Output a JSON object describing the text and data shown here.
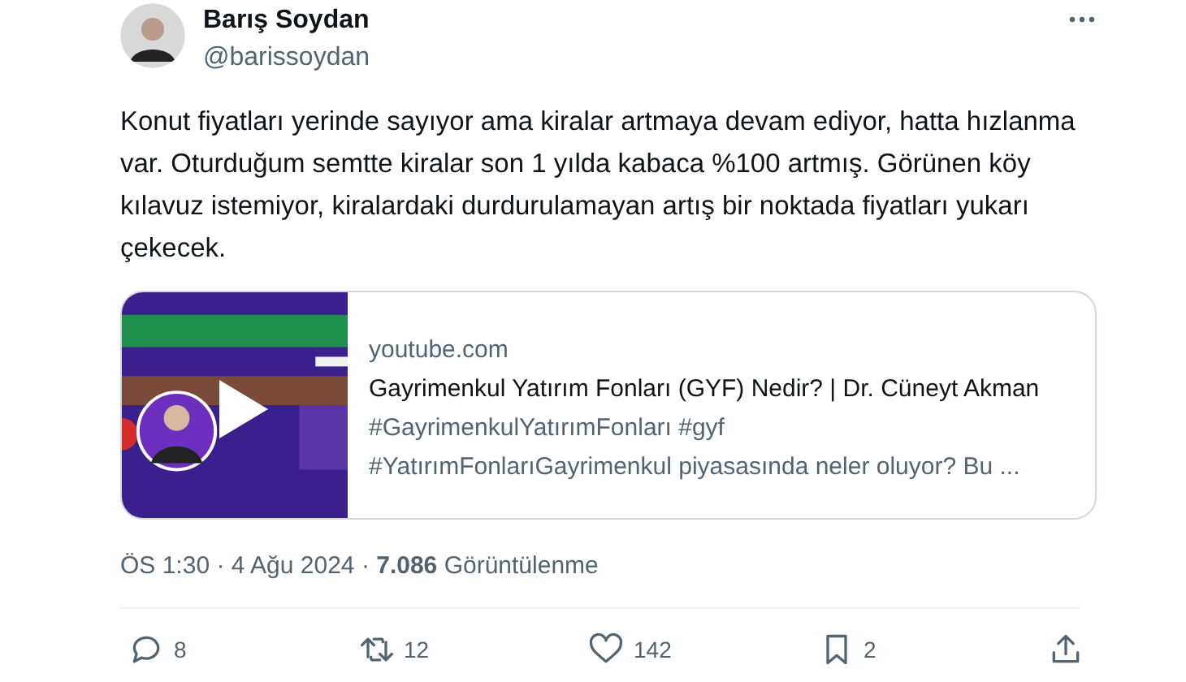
{
  "author": {
    "name": "Barış Soydan",
    "handle": "@barissoydan"
  },
  "text": "Konut fiyatları yerinde sayıyor ama kiralar artmaya devam ediyor, hatta hızlanma var. Oturduğum semtte kiralar son 1 yılda kabaca %100 artmış. Görünen köy kılavuz istemiyor, kiralardaki durdurulamayan artış bir noktada fiyatları yukarı çekecek.",
  "link_card": {
    "thumbnail": {
      "kind": "picture",
      "video": true
    },
    "domain": "youtube.com",
    "title": "Gayrimenkul Yatırım Fonları (GYF) Nedir? | Dr. Cüneyt Akman",
    "description_lines": [
      "#GayrimenkulYatırımFonları #gyf",
      "#YatırımFonlarıGayrimenkul piyasasında neler oluyor? Bu ..."
    ]
  },
  "meta": "ÖS 1:30 · 4 Ağu 2024 · **7.086** Görüntülenme",
  "actions": [
    {
      "kind": "reply",
      "count": "8"
    },
    {
      "kind": "repost",
      "count": "12"
    },
    {
      "kind": "like",
      "count": "142"
    },
    {
      "kind": "bookmark",
      "count": "2"
    },
    {
      "kind": "share"
    }
  ]
}
